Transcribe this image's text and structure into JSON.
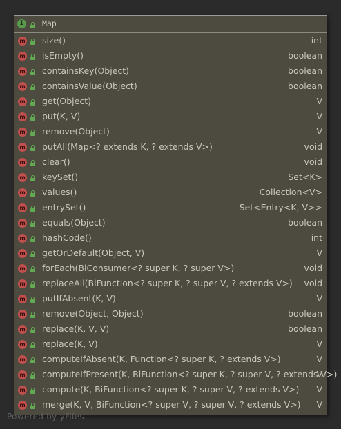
{
  "node": {
    "kind_badge": "I",
    "title": "Map",
    "members": [
      {
        "badge": "m",
        "name": "size()",
        "type": "int"
      },
      {
        "badge": "m",
        "name": "isEmpty()",
        "type": "boolean"
      },
      {
        "badge": "m",
        "name": "containsKey(Object)",
        "type": "boolean"
      },
      {
        "badge": "m",
        "name": "containsValue(Object)",
        "type": "boolean"
      },
      {
        "badge": "m",
        "name": "get(Object)",
        "type": "V"
      },
      {
        "badge": "m",
        "name": "put(K, V)",
        "type": "V"
      },
      {
        "badge": "m",
        "name": "remove(Object)",
        "type": "V"
      },
      {
        "badge": "m",
        "name": "putAll(Map<? extends K, ? extends V>)",
        "type": "void"
      },
      {
        "badge": "m",
        "name": "clear()",
        "type": "void"
      },
      {
        "badge": "m",
        "name": "keySet()",
        "type": "Set<K>"
      },
      {
        "badge": "m",
        "name": "values()",
        "type": "Collection<V>"
      },
      {
        "badge": "m",
        "name": "entrySet()",
        "type": "Set<Entry<K, V>>"
      },
      {
        "badge": "m",
        "name": "equals(Object)",
        "type": "boolean"
      },
      {
        "badge": "m",
        "name": "hashCode()",
        "type": "int"
      },
      {
        "badge": "m",
        "name": "getOrDefault(Object, V)",
        "type": "V"
      },
      {
        "badge": "m",
        "name": "forEach(BiConsumer<? super K, ? super V>)",
        "type": "void"
      },
      {
        "badge": "m",
        "name": "replaceAll(BiFunction<? super K, ? super V, ? extends V>)",
        "type": "void"
      },
      {
        "badge": "m",
        "name": "putIfAbsent(K, V)",
        "type": "V"
      },
      {
        "badge": "m",
        "name": "remove(Object, Object)",
        "type": "boolean"
      },
      {
        "badge": "m",
        "name": "replace(K, V, V)",
        "type": "boolean"
      },
      {
        "badge": "m",
        "name": "replace(K, V)",
        "type": "V"
      },
      {
        "badge": "m",
        "name": "computeIfAbsent(K, Function<? super K, ? extends V>)",
        "type": "V"
      },
      {
        "badge": "m",
        "name": "computeIfPresent(K, BiFunction<? super K, ? super V, ? extends V>)",
        "type": "V"
      },
      {
        "badge": "m",
        "name": "compute(K, BiFunction<? super K, ? super V, ? extends V>)",
        "type": "V"
      },
      {
        "badge": "m",
        "name": "merge(K, V, BiFunction<? super V, ? super V, ? extends V>)",
        "type": "V"
      }
    ]
  },
  "footer": "Powered by yFiles",
  "colors": {
    "background": "#2b2b2b",
    "node_fill": "#4d4b40",
    "interface_badge": "#5a9a4c",
    "method_badge": "#c0504d",
    "public_lock": "#63a852",
    "text": "#c9c7bd"
  }
}
